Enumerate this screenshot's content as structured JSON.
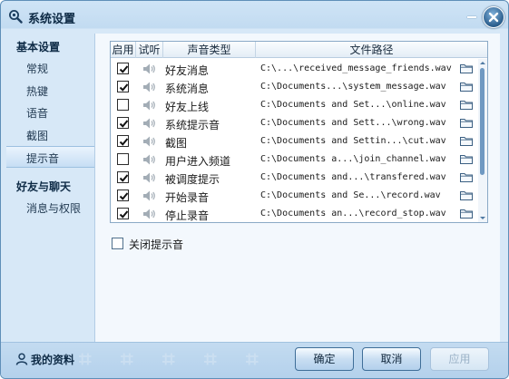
{
  "window": {
    "title": "系统设置"
  },
  "sidebar": {
    "sections": [
      {
        "heading": "基本设置",
        "items": [
          {
            "label": "常规"
          },
          {
            "label": "热键"
          },
          {
            "label": "语音"
          },
          {
            "label": "截图"
          },
          {
            "label": "提示音",
            "active": true
          }
        ]
      },
      {
        "heading": "好友与聊天",
        "items": [
          {
            "label": "消息与权限"
          }
        ]
      }
    ],
    "profile_label": "我的资料"
  },
  "sound_table": {
    "columns": [
      "启用",
      "试听",
      "声音类型",
      "文件路径"
    ],
    "rows": [
      {
        "enabled": true,
        "type": "好友消息",
        "path": "C:\\...\\received_message_friends.wav"
      },
      {
        "enabled": true,
        "type": "系统消息",
        "path": "C:\\Documents...\\system_message.wav"
      },
      {
        "enabled": false,
        "type": "好友上线",
        "path": "C:\\Documents and Set...\\online.wav"
      },
      {
        "enabled": true,
        "type": "系统提示音",
        "path": "C:\\Documents and Sett...\\wrong.wav"
      },
      {
        "enabled": true,
        "type": "截图",
        "path": "C:\\Documents and Settin...\\cut.wav"
      },
      {
        "enabled": false,
        "type": "用户进入频道",
        "path": "C:\\Documents a...\\join_channel.wav"
      },
      {
        "enabled": true,
        "type": "被调度提示",
        "path": "C:\\Documents and...\\transfered.wav"
      },
      {
        "enabled": true,
        "type": "开始录音",
        "path": "C:\\Documents and Se...\\record.wav"
      },
      {
        "enabled": true,
        "type": "停止录音",
        "path": "C:\\Documents an...\\record_stop.wav"
      }
    ]
  },
  "options": {
    "mute_label": "关闭提示音",
    "mute_checked": false
  },
  "buttons": {
    "ok": "确定",
    "cancel": "取消",
    "apply": "应用"
  },
  "icons": {
    "title": "magnifier-gear-icon",
    "close": "close-x-icon",
    "minimize": "minimize-icon",
    "play": "speaker-icon",
    "browse": "folder-icon",
    "profile": "user-icon"
  },
  "colors": {
    "window_bg": "#d7e8f7",
    "accent": "#2a5d8c",
    "border": "#8aa9c6"
  }
}
